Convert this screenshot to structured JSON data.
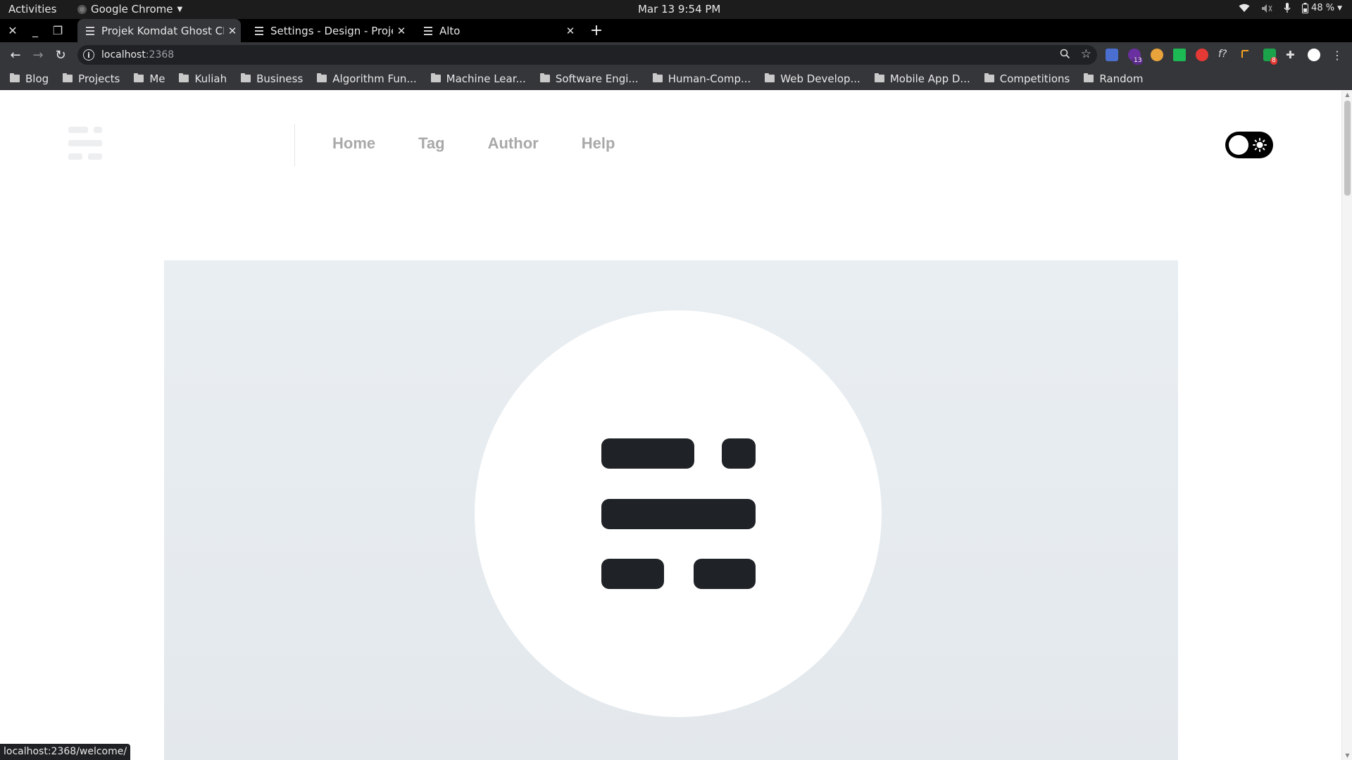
{
  "system_bar": {
    "activities": "Activities",
    "app_name": "Google Chrome",
    "clock": "Mar 13  9:54 PM",
    "battery": "48 %"
  },
  "tabs": [
    {
      "title": "Projek Komdat Ghost CMS",
      "active": true
    },
    {
      "title": "Settings - Design - Projek Komdat Ghost CMS",
      "active": false
    },
    {
      "title": "Alto",
      "active": false
    }
  ],
  "address_bar": {
    "host": "localhost",
    "port": ":2368"
  },
  "extensions": {
    "badge_a": "13",
    "badge_b": "8"
  },
  "bookmarks": [
    "Blog",
    "Projects",
    "Me",
    "Kuliah",
    "Business",
    "Algorithm Fun...",
    "Machine Lear...",
    "Software Engi...",
    "Human-Comp...",
    "Web Develop...",
    "Mobile App D...",
    "Competitions",
    "Random"
  ],
  "site": {
    "nav": [
      "Home",
      "Tag",
      "Author",
      "Help"
    ]
  },
  "status_url": "localhost:2368/welcome/",
  "colors": {
    "nav_text": "#a9a9a9",
    "hero_bg": "#e9eef2",
    "mark": "#1f2226",
    "toggle_bg": "#000000"
  }
}
